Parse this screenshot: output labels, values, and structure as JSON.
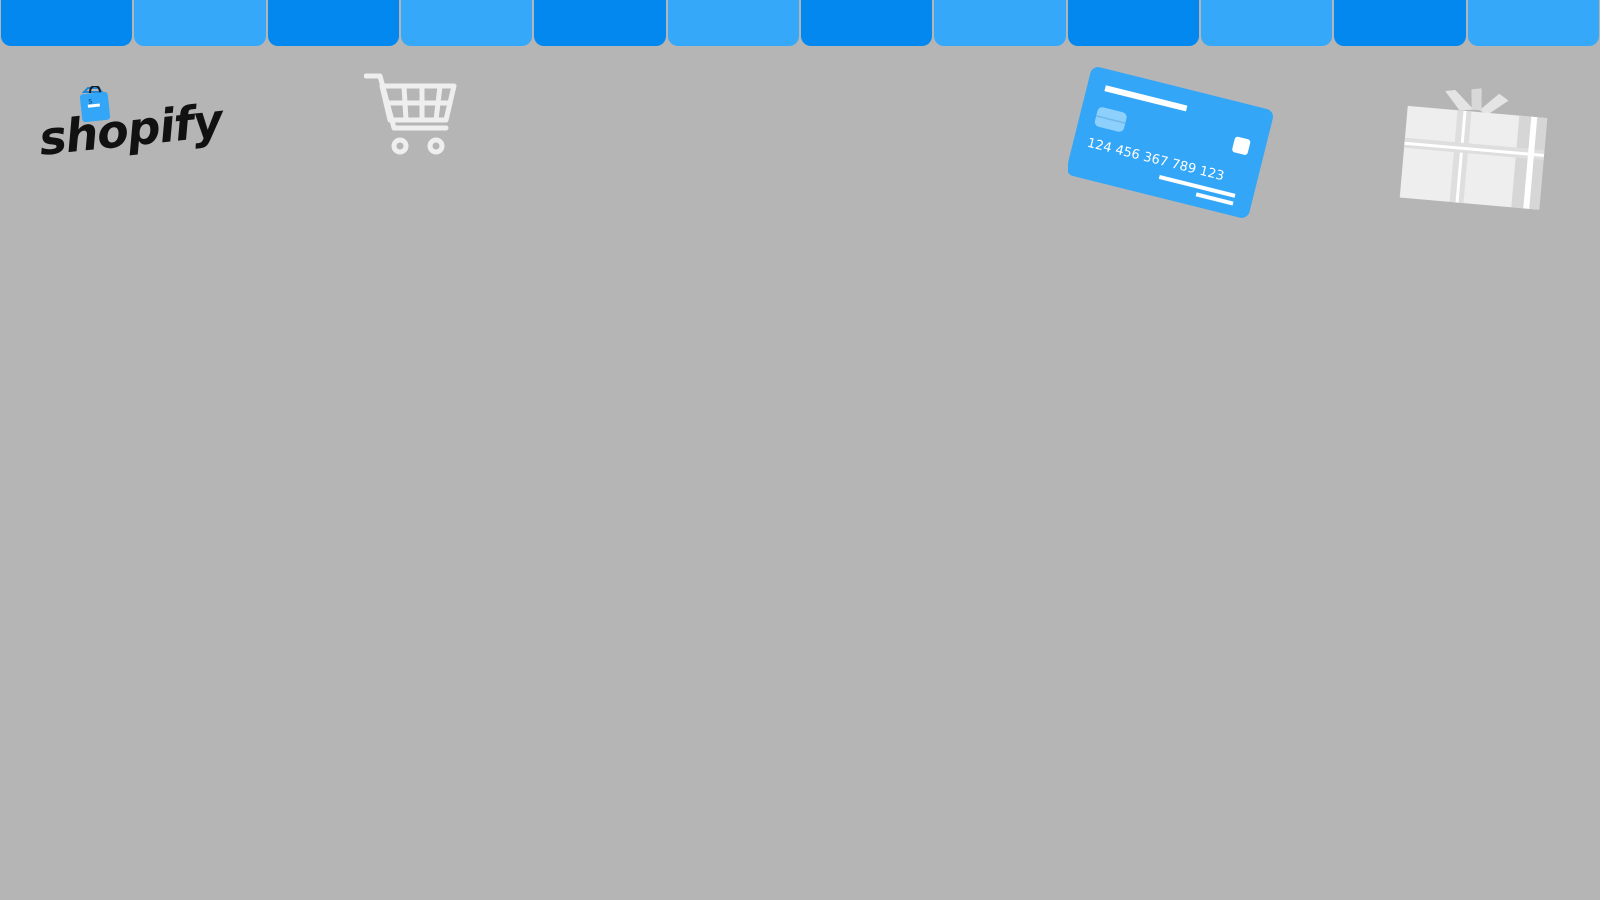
{
  "logo": {
    "text": "shopify"
  },
  "card": {
    "number": "124 456 367 789 123"
  },
  "colors": {
    "background": "#b5b5b5",
    "stripe_dark": "#0388f0",
    "stripe_light": "#35a8fa",
    "card_blue": "#33a6f8",
    "icon_light": "#eeeeee"
  },
  "awning": {
    "stripe_count": 12
  }
}
